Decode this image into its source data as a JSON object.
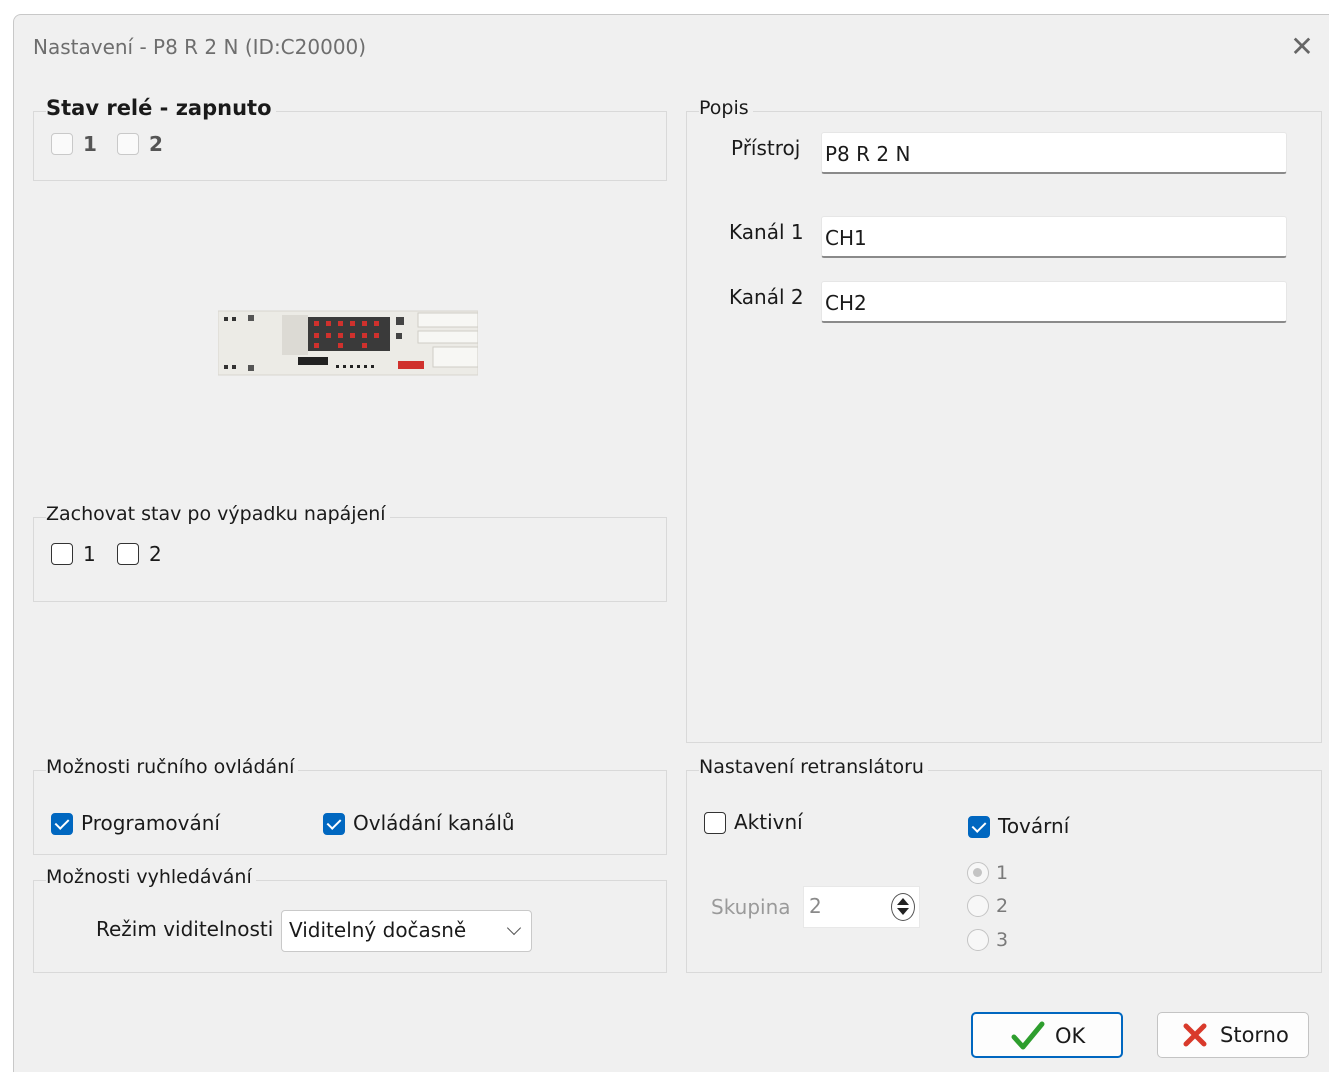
{
  "window": {
    "title": "Nastavení - P8 R 2 N (ID:C20000)"
  },
  "relay_state": {
    "legend": "Stav relé - zapnuto",
    "channels": [
      {
        "label": "1",
        "checked": false
      },
      {
        "label": "2",
        "checked": false
      }
    ]
  },
  "keep_state": {
    "legend": "Zachovat stav po výpadku napájení",
    "channels": [
      {
        "label": "1",
        "checked": false
      },
      {
        "label": "2",
        "checked": false
      }
    ]
  },
  "description": {
    "legend": "Popis",
    "fields": [
      {
        "label": "Přístroj",
        "value": "P8 R 2 N"
      },
      {
        "label": "Kanál 1",
        "value": "CH1"
      },
      {
        "label": "Kanál 2",
        "value": "CH2"
      }
    ]
  },
  "manual_control": {
    "legend": "Možnosti ručního ovládání",
    "options": [
      {
        "label": "Programování",
        "checked": true
      },
      {
        "label": "Ovládání kanálů",
        "checked": true
      }
    ]
  },
  "search": {
    "legend": "Možnosti vyhledávání",
    "visibility_label": "Režim viditelnosti",
    "visibility_value": "Viditelný dočasně"
  },
  "repeater": {
    "legend": "Nastavení retranslátoru",
    "active_label": "Aktivní",
    "active_checked": false,
    "factory_label": "Tovární",
    "factory_checked": true,
    "group_label": "Skupina",
    "group_value": "2",
    "radios": [
      {
        "label": "1",
        "selected": true
      },
      {
        "label": "2",
        "selected": false
      },
      {
        "label": "3",
        "selected": false
      }
    ]
  },
  "buttons": {
    "ok": "OK",
    "cancel": "Storno"
  },
  "icons": {
    "close": "close-icon",
    "ok": "checkmark-icon",
    "cancel": "cross-icon",
    "device": "device-image",
    "dropdown": "chevron-down-icon",
    "spin": "spin-arrows-icon"
  },
  "colors": {
    "accent": "#0067c0",
    "ok_icon": "#2e9e2e",
    "cancel_icon": "#d93a2b",
    "dialog_bg": "#f0f0f0"
  }
}
